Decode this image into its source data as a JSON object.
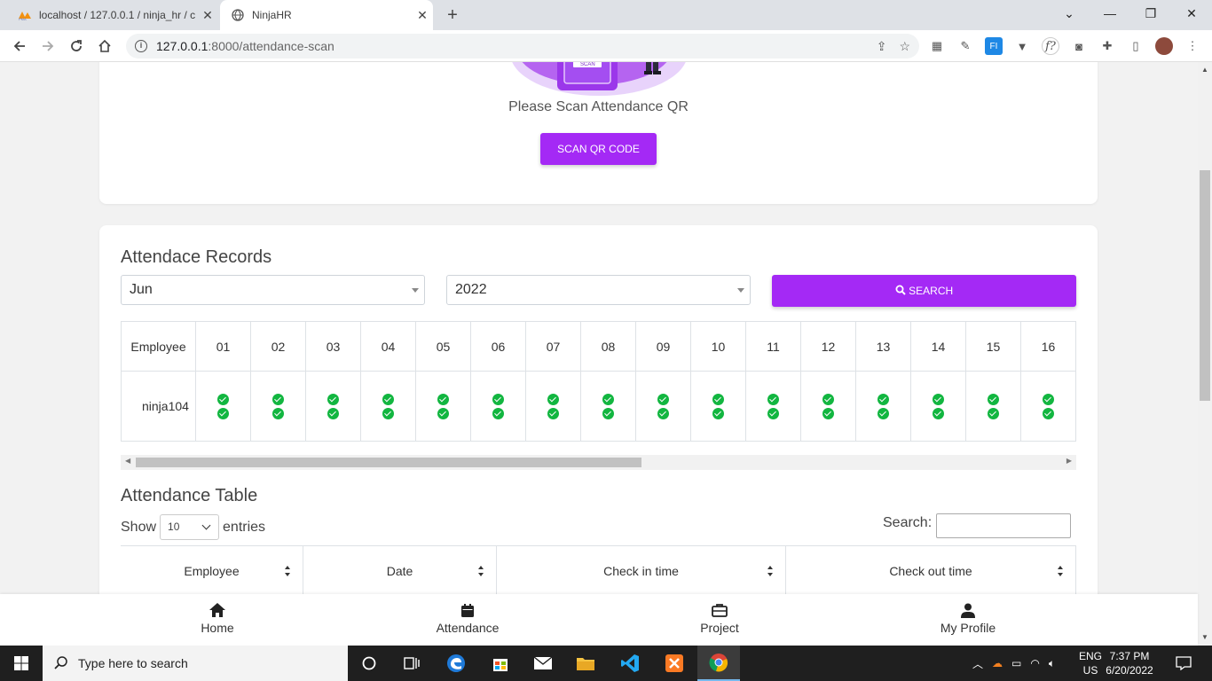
{
  "browser": {
    "tabs": [
      {
        "title": "localhost / 127.0.0.1 / ninja_hr / c",
        "active": false
      },
      {
        "title": "NinjaHR",
        "active": true
      }
    ],
    "url_host": "127.0.0.1",
    "url_rest": ":8000/attendance-scan"
  },
  "scan_card": {
    "illustration_label": "SCAN",
    "message": "Please Scan Attendance QR",
    "button_label": "SCAN QR CODE"
  },
  "attendance_records": {
    "title": "Attendace Records",
    "month_value": "Jun",
    "year_value": "2022",
    "search_label": "SEARCH",
    "header_first": "Employee",
    "days": [
      "01",
      "02",
      "03",
      "04",
      "05",
      "06",
      "07",
      "08",
      "09",
      "10",
      "11",
      "12",
      "13",
      "14",
      "15",
      "16"
    ],
    "rows": [
      {
        "employee": "ninja104"
      }
    ]
  },
  "attendance_table": {
    "title": "Attendance Table",
    "show_label": "Show",
    "entries_value": "10",
    "entries_label": "entries",
    "search_label": "Search:",
    "columns": [
      "Employee",
      "Date",
      "Check in time",
      "Check out time"
    ]
  },
  "bottom_nav": [
    {
      "label": "Home",
      "icon": "home-icon"
    },
    {
      "label": "Attendance",
      "icon": "calendar-icon"
    },
    {
      "label": "Project",
      "icon": "briefcase-icon"
    },
    {
      "label": "My Profile",
      "icon": "user-icon"
    }
  ],
  "taskbar": {
    "search_placeholder": "Type here to search",
    "lang_top": "ENG",
    "lang_bottom": "US",
    "time": "7:37 PM",
    "date": "6/20/2022"
  },
  "colors": {
    "accent": "#a429f5",
    "check": "#12b640"
  }
}
